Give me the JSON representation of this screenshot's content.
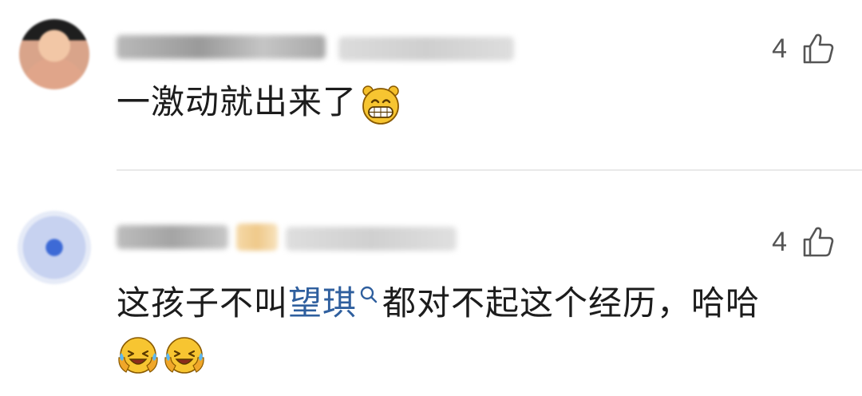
{
  "comments": [
    {
      "username": "",
      "meta": "",
      "likes": "4",
      "text": "一激动就出来了",
      "emoji": "grinning-face"
    },
    {
      "username": "",
      "meta": "",
      "likes": "4",
      "text_before": "这孩子不叫",
      "topic": "望琪",
      "text_after": "都对不起这个经历，哈哈",
      "emojis": [
        "crying-laughing-face",
        "crying-laughing-face"
      ]
    }
  ]
}
